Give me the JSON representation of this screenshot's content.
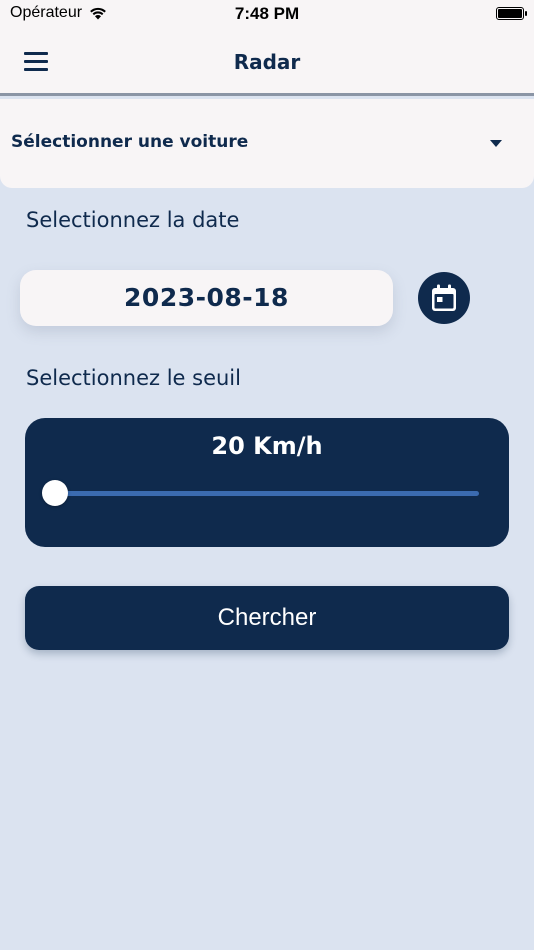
{
  "status_bar": {
    "carrier": "Opérateur",
    "time": "7:48 PM"
  },
  "appbar": {
    "title": "Radar",
    "menu_icon": "hamburger-menu-icon"
  },
  "car_select": {
    "placeholder": "Sélectionner une voiture",
    "icon": "caret-down-icon"
  },
  "date_section": {
    "label": "Selectionnez la date",
    "value": "2023-08-18",
    "icon": "calendar-icon"
  },
  "threshold_section": {
    "label": "Selectionnez le seuil",
    "value_label": "20 Km/h",
    "slider_fraction": 0.0
  },
  "search_button": {
    "label": "Chercher"
  },
  "colors": {
    "background": "#dbe3f0",
    "surface": "#f8f5f6",
    "primary": "#0f2a4d",
    "slider_track": "#3b6bb0"
  }
}
